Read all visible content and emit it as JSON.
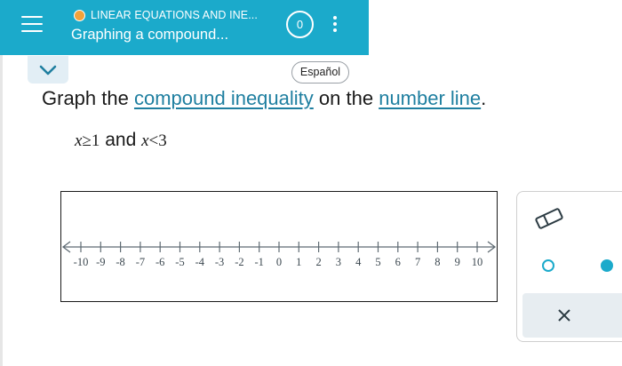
{
  "header": {
    "topic": "LINEAR EQUATIONS AND INE...",
    "lesson": "Graphing a compound...",
    "score": "0",
    "status_color": "#f2a23a",
    "accent": "#1baacb",
    "icons": [
      "menu-icon",
      "more-icon"
    ]
  },
  "language_button": "Español",
  "question": {
    "prefix": "Graph the",
    "link1": "compound inequality",
    "middle": "on the",
    "link2": "number line",
    "suffix": "."
  },
  "inequality": {
    "left_var": "x",
    "left_sym": "≥",
    "left_val": "1",
    "conj": "and",
    "right_var": "x",
    "right_sym": "<",
    "right_val": "3"
  },
  "number_line": {
    "min": -10,
    "max": 10,
    "tick_labels": [
      "-10",
      "-9",
      "-8",
      "-7",
      "-6",
      "-5",
      "-4",
      "-3",
      "-2",
      "-1",
      "0",
      "1",
      "2",
      "3",
      "4",
      "5",
      "6",
      "7",
      "8",
      "9",
      "10"
    ]
  },
  "tools": {
    "eraser": "eraser-icon",
    "open_point": "open-circle-icon",
    "closed_point": "closed-circle-icon",
    "clear": "close-icon"
  }
}
